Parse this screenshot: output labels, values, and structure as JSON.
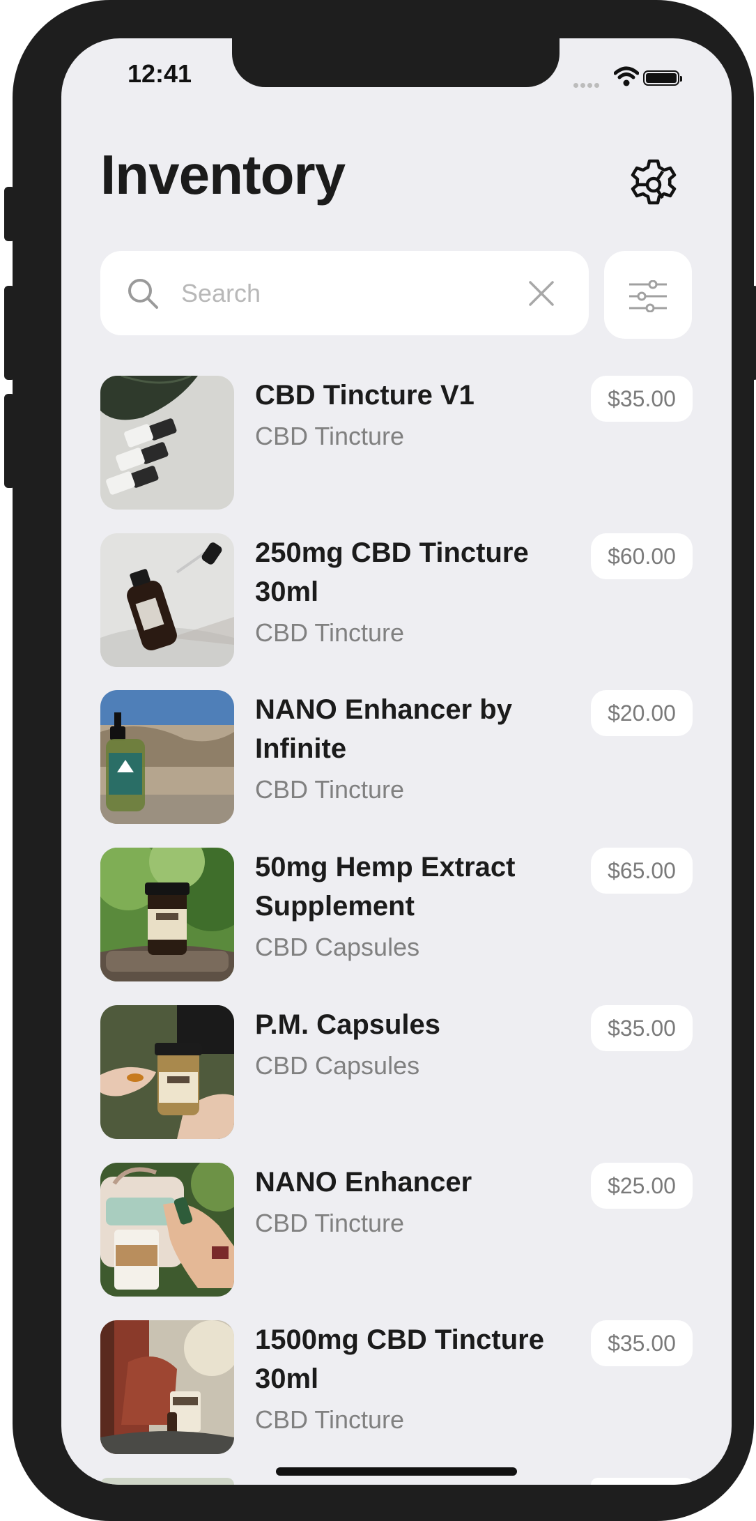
{
  "status_bar": {
    "time": "12:41"
  },
  "header": {
    "title": "Inventory"
  },
  "search": {
    "placeholder": "Search",
    "value": ""
  },
  "products": [
    {
      "name": "CBD Tincture V1",
      "category": "CBD Tincture",
      "price": "$35.00",
      "image": "tincture-bottles-photo"
    },
    {
      "name": "250mg CBD Tincture 30ml",
      "category": "CBD Tincture",
      "price": "$60.00",
      "image": "amber-bottle-dropper-photo"
    },
    {
      "name": "NANO Enhancer by Infinite",
      "category": "CBD Tincture",
      "price": "$20.00",
      "image": "green-bottle-outdoor-photo"
    },
    {
      "name": "50mg Hemp Extract Supplement",
      "category": "CBD Capsules",
      "price": "$65.00",
      "image": "jar-on-stump-photo"
    },
    {
      "name": "P.M. Capsules",
      "category": "CBD Capsules",
      "price": "$35.00",
      "image": "capsules-in-hand-photo"
    },
    {
      "name": "NANO Enhancer",
      "category": "CBD Tincture",
      "price": "$25.00",
      "image": "coffee-cup-spray-photo"
    },
    {
      "name": "1500mg CBD Tincture 30ml",
      "category": "CBD Tincture",
      "price": "$35.00",
      "image": "person-holding-box-photo"
    }
  ],
  "icons": {
    "settings": "gear-icon",
    "search": "search-icon",
    "clear": "close-icon",
    "filter": "sliders-icon"
  },
  "colors": {
    "background": "#eeeef2",
    "card": "#ffffff",
    "title": "#1b1b1b",
    "subtitle": "#808080",
    "price": "#7a7a7a",
    "device_frame": "#1e1e1e"
  }
}
